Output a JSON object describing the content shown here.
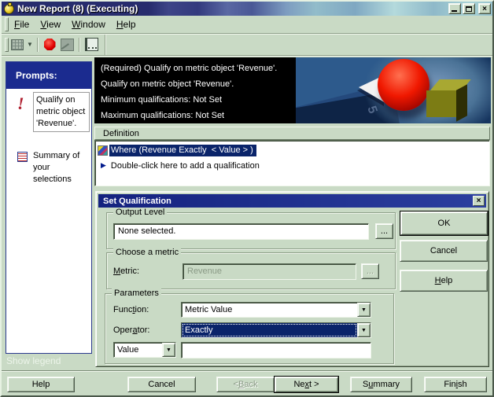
{
  "colors": {
    "app_bg": "#c9dac5",
    "navy_header": "#1b2b8f",
    "selection_navy": "#0a246a",
    "alert_red": "#b02030",
    "status_panel_bg": "#000000"
  },
  "window": {
    "title": "New Report (8) (Executing)",
    "controls": {
      "close_glyph": "×"
    }
  },
  "menu": {
    "items": [
      {
        "pre": "",
        "key": "F",
        "post": "ile"
      },
      {
        "pre": "",
        "key": "V",
        "post": "iew"
      },
      {
        "pre": "",
        "key": "W",
        "post": "indow"
      },
      {
        "pre": "",
        "key": "H",
        "post": "elp"
      }
    ]
  },
  "toolbar": {
    "dropdown_glyph": "▼",
    "icons": [
      "report-grid-icon",
      "stop-execution-icon",
      "graph-icon",
      "notes-icon"
    ]
  },
  "prompts": {
    "title": "Prompts:",
    "alert_glyph": "!",
    "items": [
      {
        "label": "Qualify on metric object 'Revenue'."
      },
      {
        "label": "Summary of your selections"
      }
    ],
    "show_legend": "Show legend"
  },
  "status_header": {
    "lines": [
      "(Required) Qualify on metric object 'Revenue'.",
      "Qualify on metric object 'Revenue'.",
      "Minimum qualifications: Not Set",
      "Maximum qualifications: Not Set"
    ]
  },
  "definition": {
    "title": "Definition",
    "row_marker": "▶",
    "rows": [
      {
        "label": "Where (Revenue Exactly  < Value > )",
        "selected": true
      },
      {
        "label": "Double-click here to add a qualification",
        "selected": false
      }
    ]
  },
  "dialog": {
    "title": "Set Qualification",
    "close_glyph": "×",
    "combo_arrow": "▼",
    "output_level": {
      "label": "Output Level",
      "value": "None selected.",
      "browse": "..."
    },
    "choose_metric": {
      "label": "Choose a metric",
      "field_label": {
        "pre": "",
        "key": "M",
        "post": "etric:"
      },
      "value": "Revenue",
      "browse": "..."
    },
    "parameters": {
      "label": "Parameters",
      "function": {
        "label": {
          "pre": "Func",
          "key": "t",
          "post": "ion:"
        },
        "value": "Metric Value"
      },
      "operator": {
        "label": {
          "pre": "Oper",
          "key": "a",
          "post": "tor:"
        },
        "value": "Exactly"
      },
      "value_row": {
        "type_value": "Value",
        "input_value": ""
      }
    },
    "buttons": {
      "ok": "OK",
      "cancel": "Cancel",
      "help": {
        "pre": "",
        "key": "H",
        "post": "elp"
      }
    }
  },
  "footer": {
    "buttons": [
      {
        "id": "help",
        "pre": "Help",
        "key": "",
        "post": ""
      },
      {
        "id": "cancel",
        "pre": "Cancel",
        "key": "",
        "post": ""
      },
      {
        "id": "back",
        "pre": "< ",
        "key": "B",
        "post": "ack"
      },
      {
        "id": "next",
        "pre": "Ne",
        "key": "x",
        "post": "t >"
      },
      {
        "id": "summary",
        "pre": "S",
        "key": "u",
        "post": "mmary"
      },
      {
        "id": "finish",
        "pre": "Fin",
        "key": "i",
        "post": "sh"
      }
    ]
  }
}
